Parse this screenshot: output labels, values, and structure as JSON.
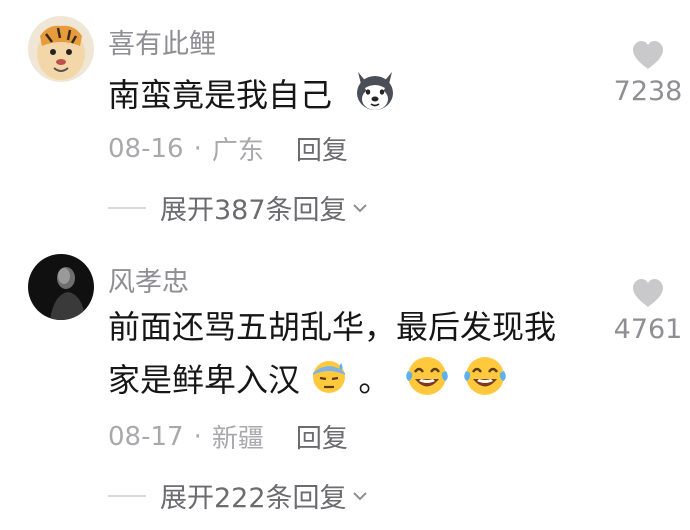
{
  "comments": [
    {
      "username": "喜有此鲤",
      "text_line1": "南蛮竟是我自己",
      "text_line2": "",
      "emoji_icons": [
        "husky-face-icon"
      ],
      "date": "08-16",
      "location": "广东",
      "reply_label": "回复",
      "like_count": "7238",
      "expand_label": "展开387条回复"
    },
    {
      "username": "风孝忠",
      "text_line1": "前面还骂五胡乱华，最后发现我",
      "text_line2": "家是鲜卑入汉",
      "text_line2_suffix": "。",
      "emoji_icons": [
        "sweat-face-icon",
        "tears-of-joy-icon",
        "tears-of-joy-icon"
      ],
      "date": "08-17",
      "location": "新疆",
      "reply_label": "回复",
      "like_count": "4761",
      "expand_label": "展开222条回复"
    }
  ],
  "separator_dot": "·",
  "colors": {
    "username": "#8e8e93",
    "text": "#161616",
    "meta": "#a9a9ad",
    "heart": "#c9c9cc"
  }
}
